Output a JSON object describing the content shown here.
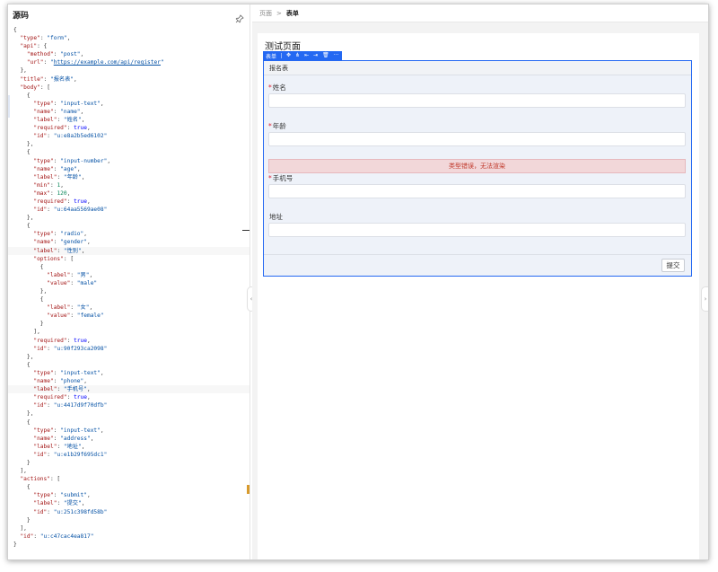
{
  "left_panel": {
    "title": "源码"
  },
  "code_lines": [
    [
      [
        "p",
        "{"
      ]
    ],
    [
      [
        "p",
        "  "
      ],
      [
        "k",
        "\"type\""
      ],
      [
        "p",
        ": "
      ],
      [
        "s",
        "\"form\""
      ],
      [
        "p",
        ","
      ]
    ],
    [
      [
        "p",
        "  "
      ],
      [
        "k",
        "\"api\""
      ],
      [
        "p",
        ": {"
      ]
    ],
    [
      [
        "p",
        "    "
      ],
      [
        "k",
        "\"method\""
      ],
      [
        "p",
        ": "
      ],
      [
        "s",
        "\"post\""
      ],
      [
        "p",
        ","
      ]
    ],
    [
      [
        "p",
        "    "
      ],
      [
        "k",
        "\"url\""
      ],
      [
        "p",
        ": "
      ],
      [
        "s",
        "\""
      ],
      [
        "su",
        "https://example.com/api/register"
      ],
      [
        "s",
        "\""
      ]
    ],
    [
      [
        "p",
        "  },"
      ]
    ],
    [
      [
        "p",
        "  "
      ],
      [
        "k",
        "\"title\""
      ],
      [
        "p",
        ": "
      ],
      [
        "s",
        "\"报名表\""
      ],
      [
        "p",
        ","
      ]
    ],
    [
      [
        "p",
        "  "
      ],
      [
        "k",
        "\"body\""
      ],
      [
        "p",
        ": ["
      ]
    ],
    [
      [
        "p",
        "    {"
      ]
    ],
    [
      [
        "p",
        "      "
      ],
      [
        "k",
        "\"type\""
      ],
      [
        "p",
        ": "
      ],
      [
        "s",
        "\"input-text\""
      ],
      [
        "p",
        ","
      ]
    ],
    [
      [
        "p",
        "      "
      ],
      [
        "k",
        "\"name\""
      ],
      [
        "p",
        ": "
      ],
      [
        "s",
        "\"name\""
      ],
      [
        "p",
        ","
      ]
    ],
    [
      [
        "p",
        "      "
      ],
      [
        "k",
        "\"label\""
      ],
      [
        "p",
        ": "
      ],
      [
        "s",
        "\"姓名\""
      ],
      [
        "p",
        ","
      ]
    ],
    [
      [
        "p",
        "      "
      ],
      [
        "k",
        "\"required\""
      ],
      [
        "p",
        ": "
      ],
      [
        "kw",
        "true"
      ],
      [
        "p",
        ","
      ]
    ],
    [
      [
        "p",
        "      "
      ],
      [
        "k",
        "\"id\""
      ],
      [
        "p",
        ": "
      ],
      [
        "s",
        "\"u:e8a2b5ed6102\""
      ]
    ],
    [
      [
        "p",
        "    },"
      ]
    ],
    [
      [
        "p",
        "    {"
      ]
    ],
    [
      [
        "p",
        "      "
      ],
      [
        "k",
        "\"type\""
      ],
      [
        "p",
        ": "
      ],
      [
        "s",
        "\"input-number\""
      ],
      [
        "p",
        ","
      ]
    ],
    [
      [
        "p",
        "      "
      ],
      [
        "k",
        "\"name\""
      ],
      [
        "p",
        ": "
      ],
      [
        "s",
        "\"age\""
      ],
      [
        "p",
        ","
      ]
    ],
    [
      [
        "p",
        "      "
      ],
      [
        "k",
        "\"label\""
      ],
      [
        "p",
        ": "
      ],
      [
        "s",
        "\"年龄\""
      ],
      [
        "p",
        ","
      ]
    ],
    [
      [
        "p",
        "      "
      ],
      [
        "k",
        "\"min\""
      ],
      [
        "p",
        ": "
      ],
      [
        "n",
        "1"
      ],
      [
        "p",
        ","
      ]
    ],
    [
      [
        "p",
        "      "
      ],
      [
        "k",
        "\"max\""
      ],
      [
        "p",
        ": "
      ],
      [
        "n",
        "120"
      ],
      [
        "p",
        ","
      ]
    ],
    [
      [
        "p",
        "      "
      ],
      [
        "k",
        "\"required\""
      ],
      [
        "p",
        ": "
      ],
      [
        "kw",
        "true"
      ],
      [
        "p",
        ","
      ]
    ],
    [
      [
        "p",
        "      "
      ],
      [
        "k",
        "\"id\""
      ],
      [
        "p",
        ": "
      ],
      [
        "s",
        "\"u:64aa5569ae08\""
      ]
    ],
    [
      [
        "p",
        "    },"
      ]
    ],
    [
      [
        "p",
        "    {"
      ]
    ],
    [
      [
        "p",
        "      "
      ],
      [
        "k",
        "\"type\""
      ],
      [
        "p",
        ": "
      ],
      [
        "s",
        "\"radio\""
      ],
      [
        "p",
        ","
      ]
    ],
    [
      [
        "p",
        "      "
      ],
      [
        "k",
        "\"name\""
      ],
      [
        "p",
        ": "
      ],
      [
        "s",
        "\"gender\""
      ],
      [
        "p",
        ","
      ]
    ],
    [
      [
        "p",
        "      "
      ],
      [
        "k",
        "\"label\""
      ],
      [
        "p",
        ": "
      ],
      [
        "s",
        "\"性别\""
      ],
      [
        "p",
        ","
      ]
    ],
    [
      [
        "p",
        "      "
      ],
      [
        "k",
        "\"options\""
      ],
      [
        "p",
        ": ["
      ]
    ],
    [
      [
        "p",
        "        {"
      ]
    ],
    [
      [
        "p",
        "          "
      ],
      [
        "k",
        "\"label\""
      ],
      [
        "p",
        ": "
      ],
      [
        "s",
        "\"男\""
      ],
      [
        "p",
        ","
      ]
    ],
    [
      [
        "p",
        "          "
      ],
      [
        "k",
        "\"value\""
      ],
      [
        "p",
        ": "
      ],
      [
        "s",
        "\"male\""
      ]
    ],
    [
      [
        "p",
        "        },"
      ]
    ],
    [
      [
        "p",
        "        {"
      ]
    ],
    [
      [
        "p",
        "          "
      ],
      [
        "k",
        "\"label\""
      ],
      [
        "p",
        ": "
      ],
      [
        "s",
        "\"女\""
      ],
      [
        "p",
        ","
      ]
    ],
    [
      [
        "p",
        "          "
      ],
      [
        "k",
        "\"value\""
      ],
      [
        "p",
        ": "
      ],
      [
        "s",
        "\"female\""
      ]
    ],
    [
      [
        "p",
        "        }"
      ]
    ],
    [
      [
        "p",
        "      ],"
      ]
    ],
    [
      [
        "p",
        "      "
      ],
      [
        "k",
        "\"required\""
      ],
      [
        "p",
        ": "
      ],
      [
        "kw",
        "true"
      ],
      [
        "p",
        ","
      ]
    ],
    [
      [
        "p",
        "      "
      ],
      [
        "k",
        "\"id\""
      ],
      [
        "p",
        ": "
      ],
      [
        "s",
        "\"u:90f293ca2098\""
      ]
    ],
    [
      [
        "p",
        "    },"
      ]
    ],
    [
      [
        "p",
        "    {"
      ]
    ],
    [
      [
        "p",
        "      "
      ],
      [
        "k",
        "\"type\""
      ],
      [
        "p",
        ": "
      ],
      [
        "s",
        "\"input-text\""
      ],
      [
        "p",
        ","
      ]
    ],
    [
      [
        "p",
        "      "
      ],
      [
        "k",
        "\"name\""
      ],
      [
        "p",
        ": "
      ],
      [
        "s",
        "\"phone\""
      ],
      [
        "p",
        ","
      ]
    ],
    [
      [
        "p",
        "      "
      ],
      [
        "k",
        "\"label\""
      ],
      [
        "p",
        ": "
      ],
      [
        "s",
        "\"手机号\""
      ],
      [
        "p",
        ","
      ]
    ],
    [
      [
        "p",
        "      "
      ],
      [
        "k",
        "\"required\""
      ],
      [
        "p",
        ": "
      ],
      [
        "kw",
        "true"
      ],
      [
        "p",
        ","
      ]
    ],
    [
      [
        "p",
        "      "
      ],
      [
        "k",
        "\"id\""
      ],
      [
        "p",
        ": "
      ],
      [
        "s",
        "\"u:4417d9f70dfb\""
      ]
    ],
    [
      [
        "p",
        "    },"
      ]
    ],
    [
      [
        "p",
        "    {"
      ]
    ],
    [
      [
        "p",
        "      "
      ],
      [
        "k",
        "\"type\""
      ],
      [
        "p",
        ": "
      ],
      [
        "s",
        "\"input-text\""
      ],
      [
        "p",
        ","
      ]
    ],
    [
      [
        "p",
        "      "
      ],
      [
        "k",
        "\"name\""
      ],
      [
        "p",
        ": "
      ],
      [
        "s",
        "\"address\""
      ],
      [
        "p",
        ","
      ]
    ],
    [
      [
        "p",
        "      "
      ],
      [
        "k",
        "\"label\""
      ],
      [
        "p",
        ": "
      ],
      [
        "s",
        "\"地址\""
      ],
      [
        "p",
        ","
      ]
    ],
    [
      [
        "p",
        "      "
      ],
      [
        "k",
        "\"id\""
      ],
      [
        "p",
        ": "
      ],
      [
        "s",
        "\"u:e1b29f695dc1\""
      ]
    ],
    [
      [
        "p",
        "    }"
      ]
    ],
    [
      [
        "p",
        "  ],"
      ]
    ],
    [
      [
        "p",
        "  "
      ],
      [
        "k",
        "\"actions\""
      ],
      [
        "p",
        ": ["
      ]
    ],
    [
      [
        "p",
        "    {"
      ]
    ],
    [
      [
        "p",
        "      "
      ],
      [
        "k",
        "\"type\""
      ],
      [
        "p",
        ": "
      ],
      [
        "s",
        "\"submit\""
      ],
      [
        "p",
        ","
      ]
    ],
    [
      [
        "p",
        "      "
      ],
      [
        "k",
        "\"label\""
      ],
      [
        "p",
        ": "
      ],
      [
        "s",
        "\"提交\""
      ],
      [
        "p",
        ","
      ]
    ],
    [
      [
        "p",
        "      "
      ],
      [
        "k",
        "\"id\""
      ],
      [
        "p",
        ": "
      ],
      [
        "s",
        "\"u:251c398fd58b\""
      ]
    ],
    [
      [
        "p",
        "    }"
      ]
    ],
    [
      [
        "p",
        "  ],"
      ]
    ],
    [
      [
        "p",
        "  "
      ],
      [
        "k",
        "\"id\""
      ],
      [
        "p",
        ": "
      ],
      [
        "s",
        "\"u:c47cac4ea817\""
      ]
    ],
    [
      [
        "p",
        "}"
      ]
    ]
  ],
  "breadcrumb": {
    "root": "页面",
    "separator": ">",
    "current": "表单"
  },
  "preview": {
    "page_title": "测试页面",
    "toolbar_label": "表单",
    "form_title": "报名表",
    "fields": [
      {
        "label": "姓名",
        "required": "*"
      },
      {
        "label": "年龄",
        "required": "*"
      },
      {
        "label": "手机号",
        "required": "*"
      },
      {
        "label": "地址",
        "required": ""
      }
    ],
    "error_text": "类型错误，无法渲染",
    "submit_label": "提交"
  },
  "colors": {
    "accent": "#2468f2",
    "error_bg": "#f2d7d9",
    "error_text": "#c0392b"
  }
}
